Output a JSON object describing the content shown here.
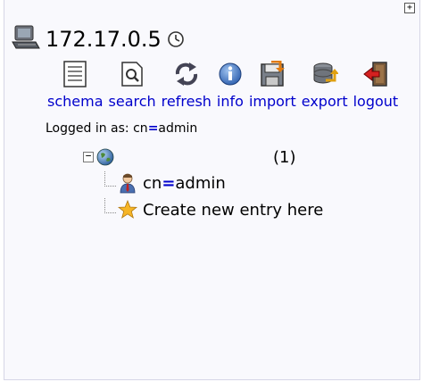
{
  "server": {
    "name": "172.17.0.5"
  },
  "toolbar": {
    "items": [
      {
        "label": "schema",
        "icon": "schema-icon"
      },
      {
        "label": "search",
        "icon": "search-icon"
      },
      {
        "label": "refresh",
        "icon": "refresh-icon"
      },
      {
        "label": "info",
        "icon": "info-icon"
      },
      {
        "label": "import",
        "icon": "import-icon"
      },
      {
        "label": "export",
        "icon": "export-icon"
      },
      {
        "label": "logout",
        "icon": "logout-icon"
      }
    ]
  },
  "login": {
    "prefix": "Logged in as: ",
    "attr": "cn",
    "eq": "=",
    "value": "admin"
  },
  "tree": {
    "root": {
      "count": "(1)",
      "expander": "−"
    },
    "children": [
      {
        "attr": "cn",
        "eq": "=",
        "value": "admin",
        "icon": "user-icon"
      },
      {
        "label": "Create new entry here",
        "icon": "star-icon"
      }
    ]
  },
  "colors": {
    "link": "#0000cc",
    "background": "#f9f9fd",
    "border": "#d6d6e6"
  }
}
